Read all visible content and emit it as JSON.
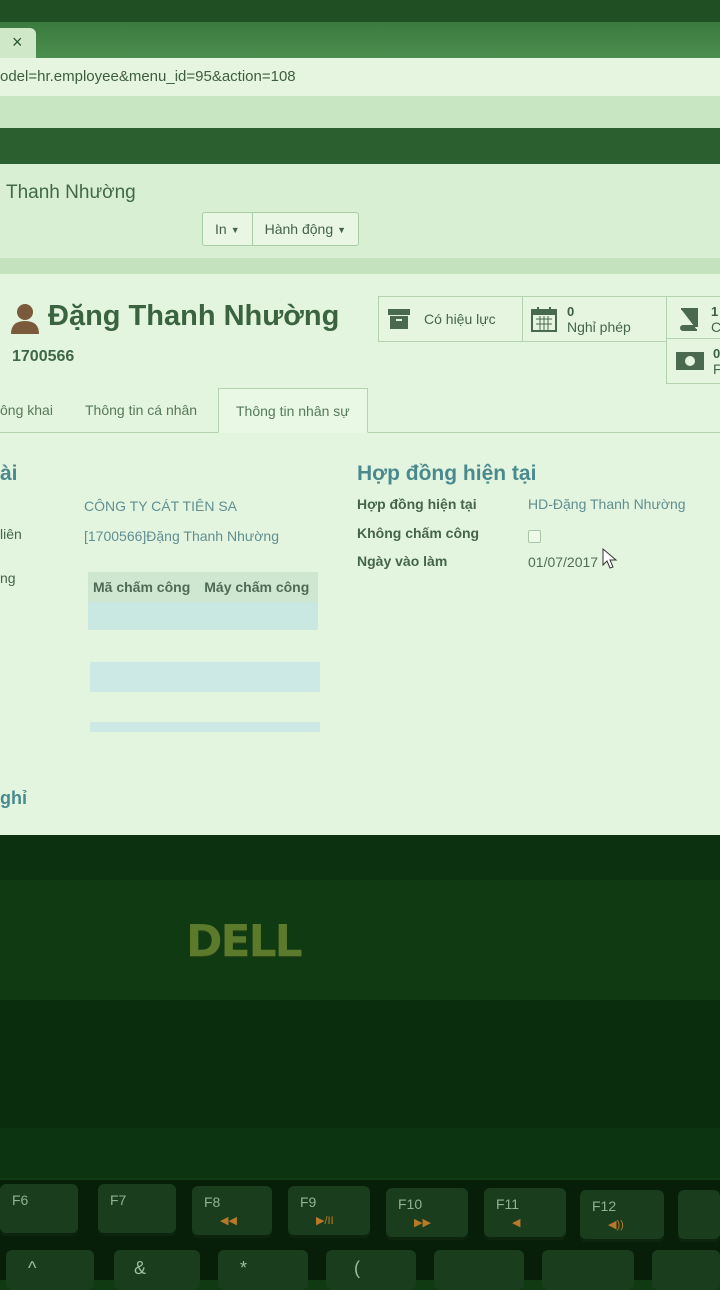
{
  "browser": {
    "tab_close": "×",
    "url": "odel=hr.employee&menu_id=95&action=108"
  },
  "control_panel": {
    "breadcrumb": "Thanh Nhường",
    "print_label": "In",
    "action_label": "Hành động"
  },
  "employee": {
    "name": "Đặng Thanh Nhường",
    "id": "1700566"
  },
  "stat_buttons": {
    "active_label": "Có hiệu lực",
    "leave_count": "0",
    "leave_label": "Nghỉ phép",
    "doc_count": "1",
    "doc_label_partial": "C",
    "payslip_count": "0",
    "payslip_label_partial": "F"
  },
  "tabs": [
    {
      "label": "ông khai"
    },
    {
      "label": "Thông tin cá nhân"
    },
    {
      "label": "Thông tin nhân sự",
      "active": true
    }
  ],
  "left_group": {
    "title_partial": "ài",
    "company_value": "CÔNG TY CÁT TIÊN SA",
    "employee_label_partial": "liên",
    "employee_value": "[1700566]Đặng Thanh Nhường",
    "attendance_label_partial": "ng",
    "table_headers": [
      "Mã chấm công",
      "Máy chấm công"
    ]
  },
  "contract_group": {
    "title": "Hợp đồng hiện tại",
    "contract_label": "Hợp đồng hiện tại",
    "contract_value": "HD-Đặng Thanh Nhường",
    "no_attendance_label": "Không chấm công",
    "no_attendance_checked": false,
    "start_date_label": "Ngày vào làm",
    "start_date_value": "01/07/2017"
  },
  "leave_group": {
    "title_partial": "ghỉ"
  },
  "laptop": {
    "brand": "DELL",
    "fkeys": [
      {
        "label": "F6",
        "glyph": ""
      },
      {
        "label": "F7",
        "glyph": ""
      },
      {
        "label": "F8",
        "glyph": "◀◀"
      },
      {
        "label": "F9",
        "glyph": "▶/II"
      },
      {
        "label": "F10",
        "glyph": "▶▶"
      },
      {
        "label": "F11",
        "glyph": "◀"
      },
      {
        "label": "F12",
        "glyph": "◀))"
      }
    ],
    "row2_keys": [
      "^",
      "&",
      "*",
      "("
    ]
  }
}
